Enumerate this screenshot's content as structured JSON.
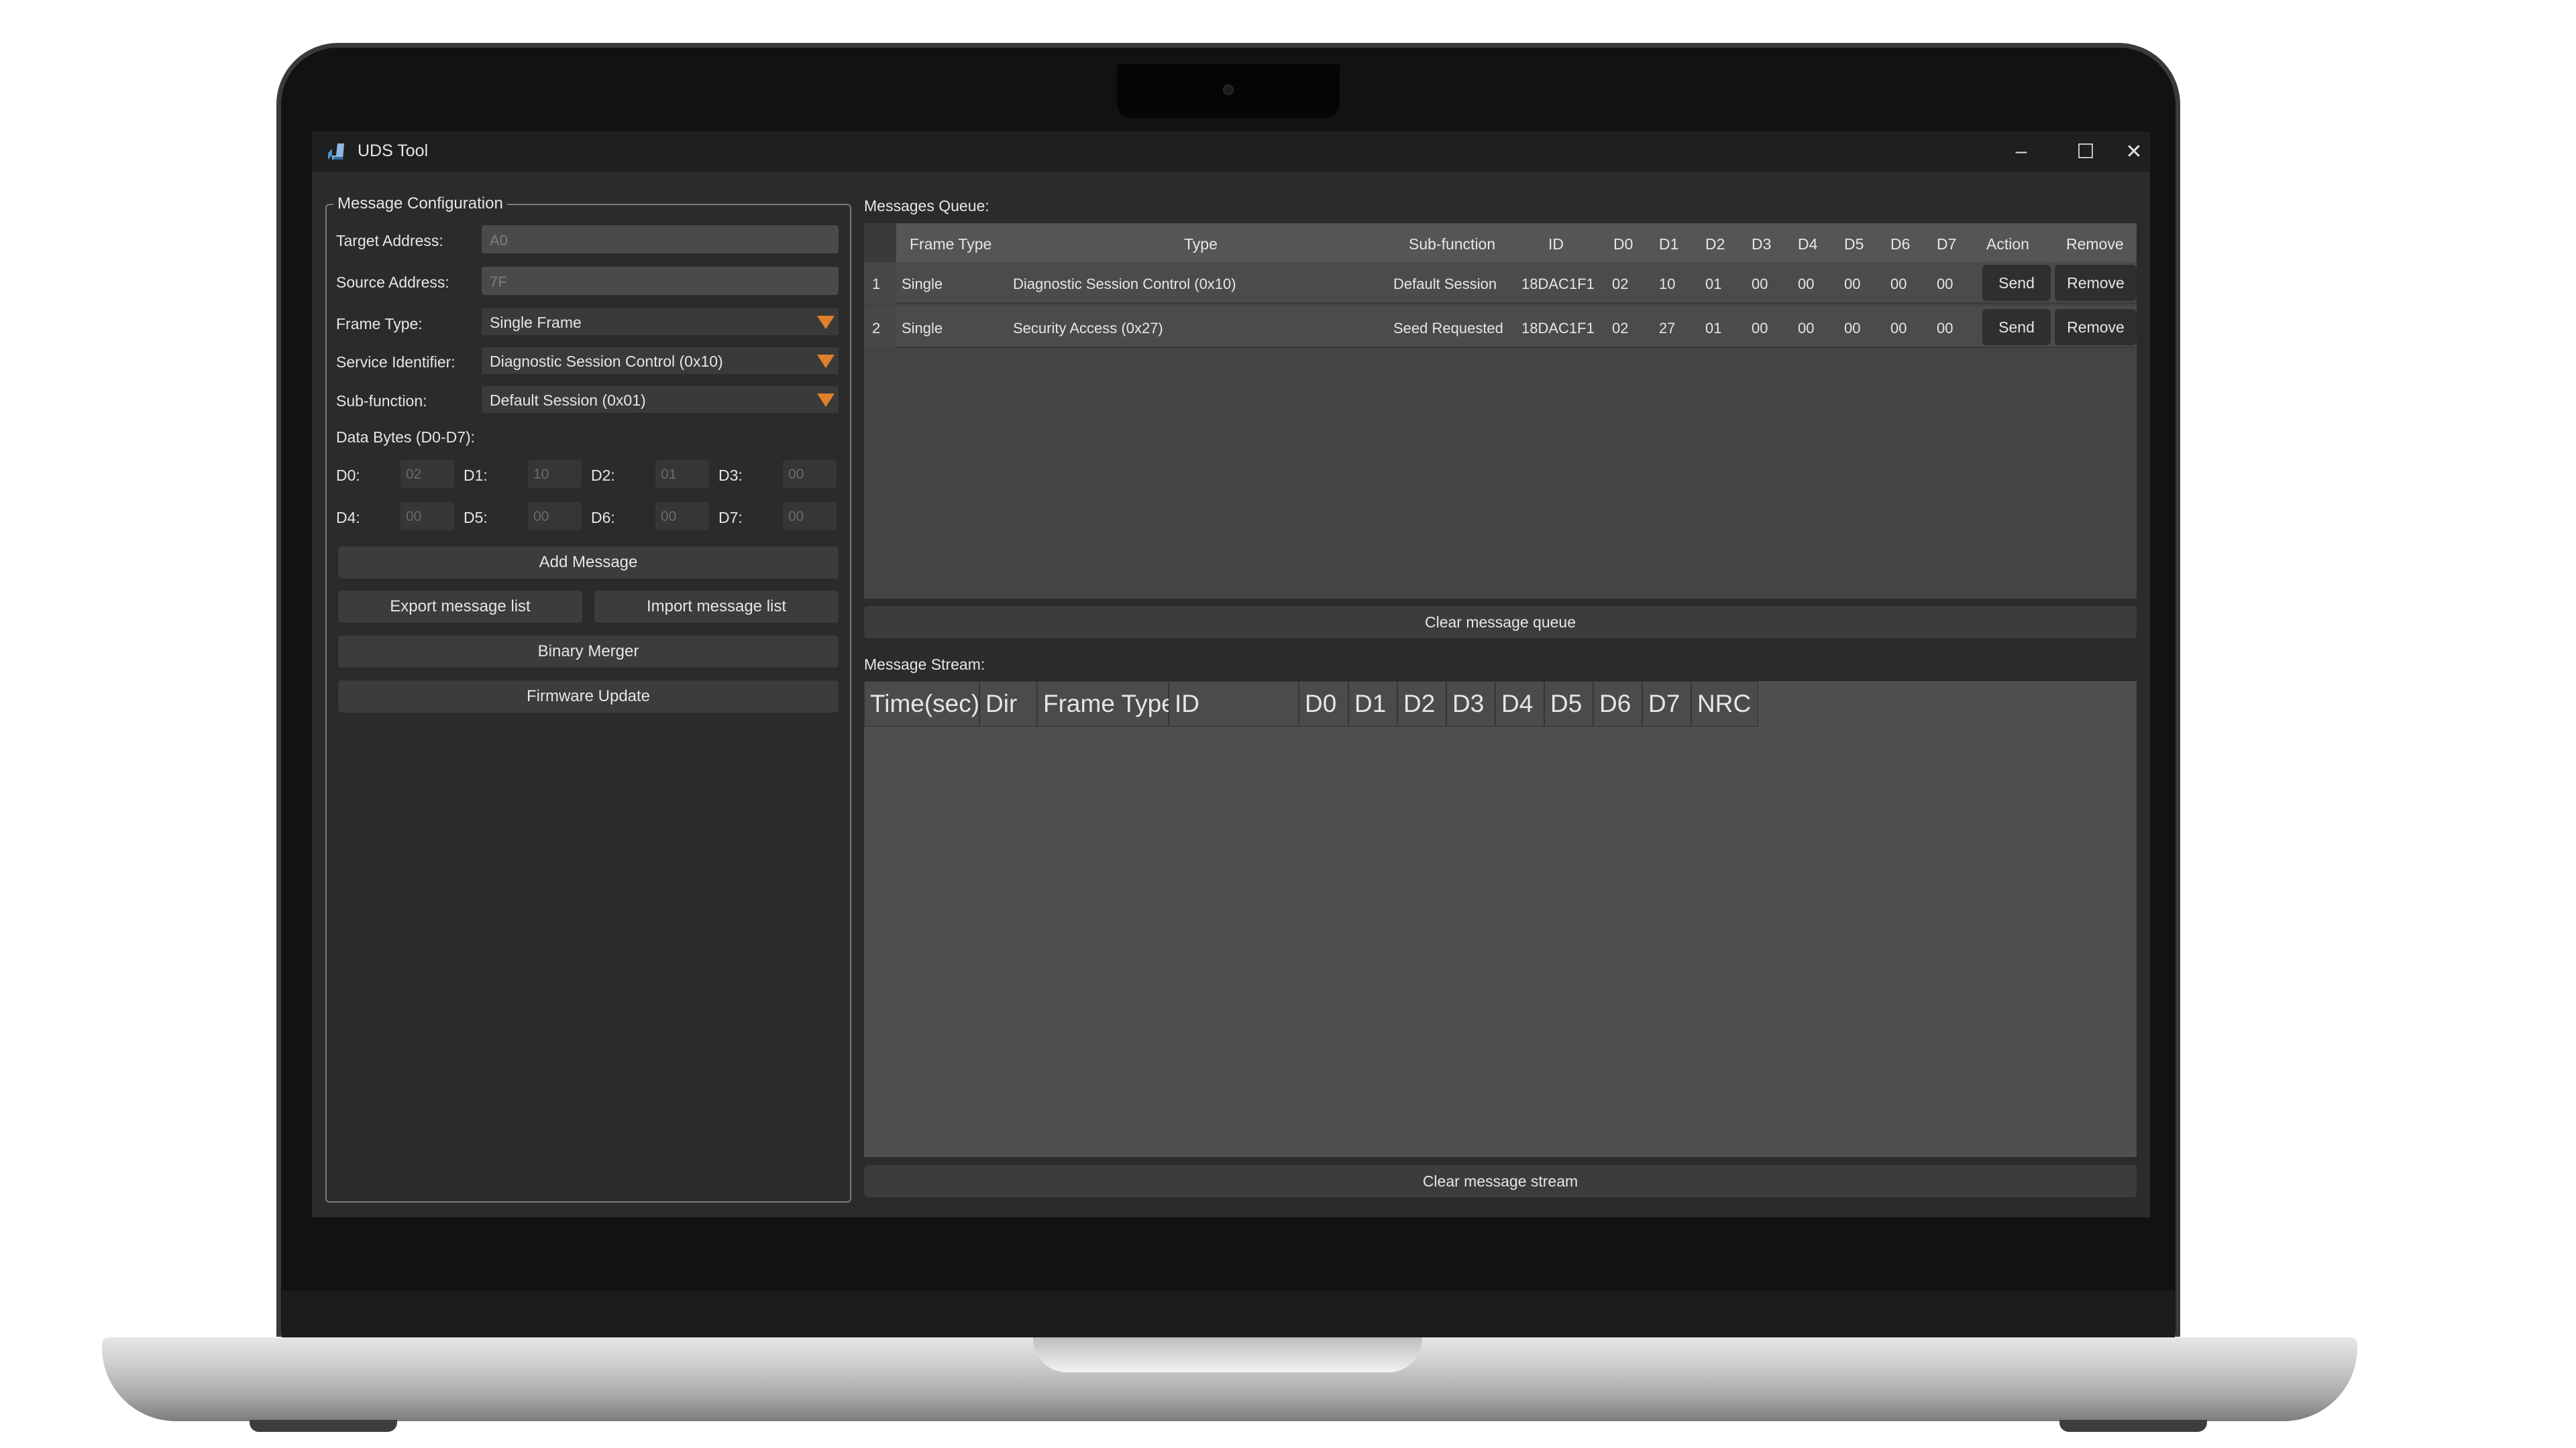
{
  "window": {
    "title": "UDS Tool",
    "minimize": "–",
    "maximize": "☐",
    "close": "✕"
  },
  "config": {
    "group_title": "Message Configuration",
    "target_address": {
      "label": "Target Address:",
      "value": "A0"
    },
    "source_address": {
      "label": "Source Address:",
      "value": "7F"
    },
    "frame_type": {
      "label": "Frame Type:",
      "value": "Single Frame"
    },
    "service_identifier": {
      "label": "Service Identifier:",
      "value": "Diagnostic Session Control (0x10)"
    },
    "sub_function": {
      "label": "Sub-function:",
      "value": "Default Session (0x01)"
    },
    "data_bytes_label": "Data Bytes (D0-D7):",
    "bytes": [
      {
        "label": "D0:",
        "value": "02"
      },
      {
        "label": "D1:",
        "value": "10"
      },
      {
        "label": "D2:",
        "value": "01"
      },
      {
        "label": "D3:",
        "value": "00"
      },
      {
        "label": "D4:",
        "value": "00"
      },
      {
        "label": "D5:",
        "value": "00"
      },
      {
        "label": "D6:",
        "value": "00"
      },
      {
        "label": "D7:",
        "value": "00"
      }
    ],
    "add_message": "Add Message",
    "export_list": "Export message list",
    "import_list": "Import message list",
    "binary_merger": "Binary Merger",
    "firmware_update": "Firmware Update"
  },
  "queue": {
    "label": "Messages Queue:",
    "columns": [
      "Frame Type",
      "Type",
      "Sub-function",
      "ID",
      "D0",
      "D1",
      "D2",
      "D3",
      "D4",
      "D5",
      "D6",
      "D7",
      "Action",
      "Remove"
    ],
    "rows": [
      {
        "num": "1",
        "frame_type": "Single",
        "type": "Diagnostic Session Control (0x10)",
        "sub_function": "Default Session",
        "id": "18DAC1F1",
        "d": [
          "02",
          "10",
          "01",
          "00",
          "00",
          "00",
          "00",
          "00"
        ],
        "action": "Send",
        "remove": "Remove"
      },
      {
        "num": "2",
        "frame_type": "Single",
        "type": "Security Access (0x27)",
        "sub_function": "Seed Requested",
        "id": "18DAC1F1",
        "d": [
          "02",
          "27",
          "01",
          "00",
          "00",
          "00",
          "00",
          "00"
        ],
        "action": "Send",
        "remove": "Remove"
      }
    ],
    "clear_button": "Clear message queue"
  },
  "stream": {
    "label": "Message Stream:",
    "columns": [
      "Time(sec)",
      "Dir",
      "Frame Type",
      "ID",
      "D0",
      "D1",
      "D2",
      "D3",
      "D4",
      "D5",
      "D6",
      "D7",
      "NRC"
    ],
    "clear_button": "Clear message stream"
  },
  "colors": {
    "accent": "#e0812a",
    "window_bg": "#2b2b2b",
    "titlebar": "#1f1f1f"
  }
}
